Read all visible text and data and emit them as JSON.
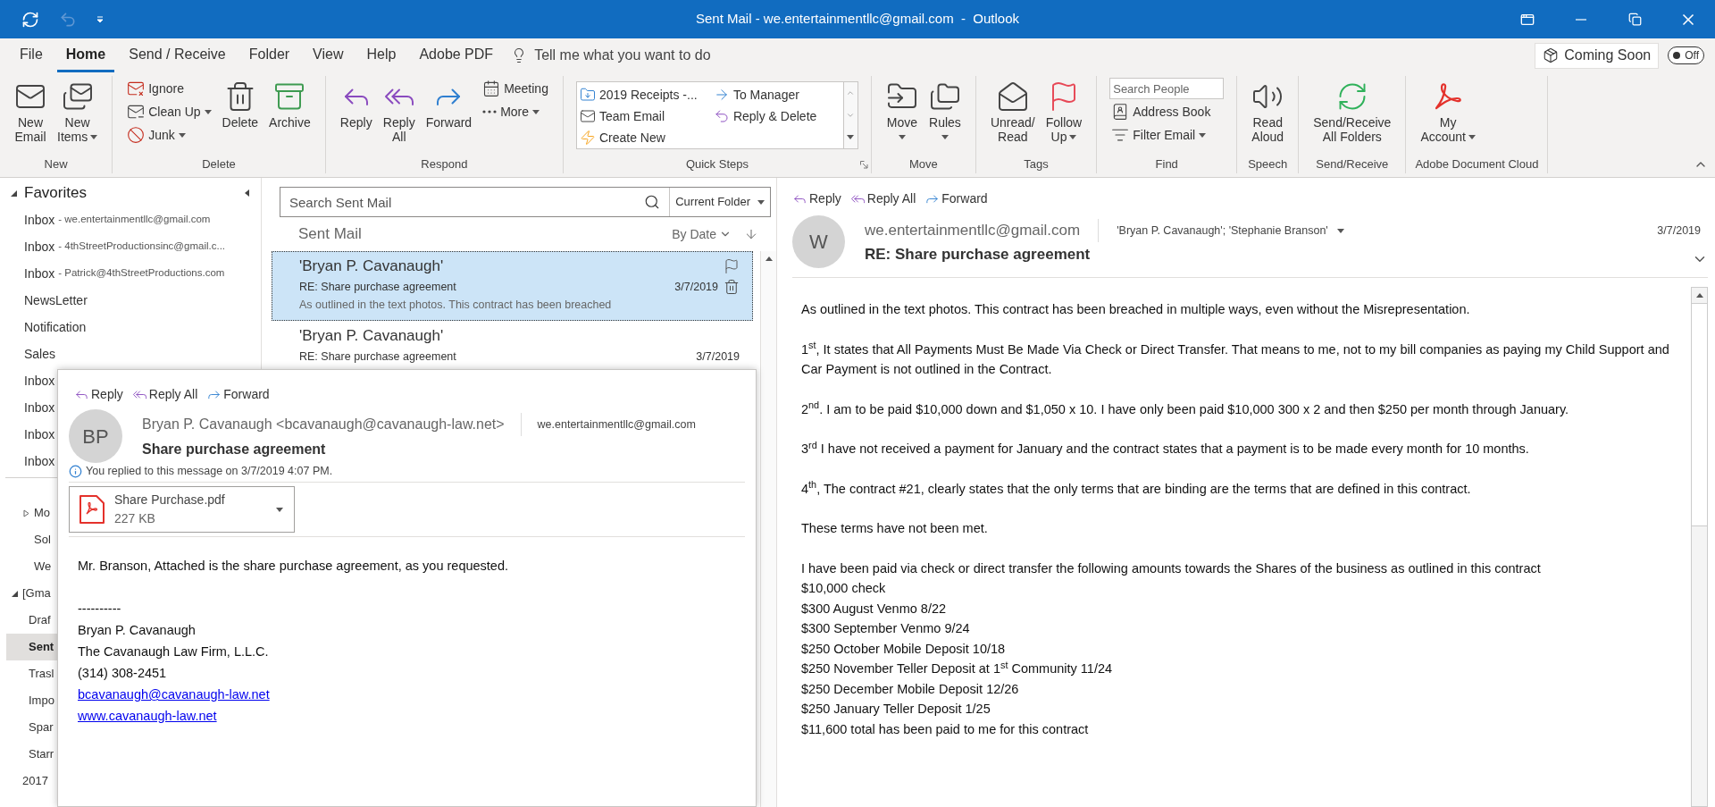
{
  "title_bar": {
    "title": "Sent Mail - we.entertainmentllc@gmail.com  -  Outlook",
    "undo": {
      "disabled": true
    }
  },
  "menu": {
    "tabs": [
      {
        "label": "File",
        "selected": false
      },
      {
        "label": "Home",
        "selected": true
      },
      {
        "label": "Send / Receive",
        "selected": false
      },
      {
        "label": "Folder",
        "selected": false
      },
      {
        "label": "View",
        "selected": false
      },
      {
        "label": "Help",
        "selected": false
      },
      {
        "label": "Adobe PDF",
        "selected": false
      }
    ],
    "tell_me": "Tell me what you want to do",
    "coming_soon": "Coming Soon",
    "toggle": {
      "label": "Off",
      "on": false
    }
  },
  "ribbon": {
    "groups": [
      {
        "label": "New",
        "launcher": false,
        "items": [
          {
            "kind": "large",
            "lines": [
              "New",
              "Email"
            ],
            "dropdown": false
          },
          {
            "kind": "large",
            "lines": [
              "New",
              "Items"
            ],
            "dropdown": true
          }
        ]
      },
      {
        "label": "Delete",
        "launcher": false,
        "items": [
          {
            "kind": "stack",
            "buttons": [
              {
                "label": "Ignore",
                "dropdown": false
              },
              {
                "label": "Clean Up",
                "dropdown": true
              },
              {
                "label": "Junk",
                "dropdown": true
              }
            ]
          },
          {
            "kind": "large",
            "lines": [
              "Delete"
            ],
            "dropdown": false
          },
          {
            "kind": "large",
            "lines": [
              "Archive"
            ],
            "dropdown": false
          }
        ]
      },
      {
        "label": "Respond",
        "launcher": false,
        "items": [
          {
            "kind": "large",
            "lines": [
              "Reply"
            ],
            "dropdown": false
          },
          {
            "kind": "large",
            "lines": [
              "Reply",
              "All"
            ],
            "dropdown": false
          },
          {
            "kind": "large",
            "lines": [
              "Forward"
            ],
            "dropdown": false
          },
          {
            "kind": "stack",
            "buttons": [
              {
                "label": "Meeting",
                "dropdown": false
              },
              {
                "label": "More",
                "dropdown": true
              }
            ]
          }
        ]
      },
      {
        "label": "Quick Steps",
        "launcher": true,
        "items": [
          {
            "kind": "gallery",
            "steps": [
              "2019 Receipts -...",
              "To Manager",
              "Team Email",
              "Reply & Delete",
              "Create New"
            ]
          }
        ]
      },
      {
        "label": "Move",
        "launcher": false,
        "items": [
          {
            "kind": "large",
            "lines": [
              "Move"
            ],
            "dropdown": true
          },
          {
            "kind": "large",
            "lines": [
              "Rules"
            ],
            "dropdown": true
          }
        ]
      },
      {
        "label": "Tags",
        "launcher": false,
        "items": [
          {
            "kind": "large",
            "lines": [
              "Unread/",
              "Read"
            ],
            "dropdown": false
          },
          {
            "kind": "large",
            "lines": [
              "Follow",
              "Up"
            ],
            "dropdown": true
          }
        ]
      },
      {
        "label": "Find",
        "launcher": false,
        "items": [
          {
            "kind": "stack",
            "placeholder": "Search People",
            "buttons": [
              {
                "label": "Address Book",
                "dropdown": false
              },
              {
                "label": "Filter Email",
                "dropdown": true
              }
            ]
          }
        ]
      },
      {
        "label": "Speech",
        "launcher": false,
        "items": [
          {
            "kind": "large",
            "lines": [
              "Read",
              "Aloud"
            ],
            "dropdown": false
          }
        ]
      },
      {
        "label": "Send/Receive",
        "launcher": false,
        "items": [
          {
            "kind": "large",
            "lines": [
              "Send/Receive",
              "All Folders"
            ],
            "dropdown": false
          }
        ]
      },
      {
        "label": "Adobe Document Cloud",
        "launcher": false,
        "items": [
          {
            "kind": "large",
            "lines": [
              "My",
              "Account"
            ],
            "dropdown": true
          }
        ]
      }
    ]
  },
  "folder_pane": {
    "title": "Favorites",
    "expanded": true,
    "favorites": [
      {
        "label": "Inbox",
        "detail": "- we.entertainmentllc@gmail.com",
        "selected": false
      },
      {
        "label": "Inbox",
        "detail": "- 4thStreetProductionsinc@gmail.c...",
        "selected": false
      },
      {
        "label": "Inbox",
        "detail": "- Patrick@4thStreetProductions.com",
        "selected": false
      },
      {
        "label": "NewsLetter",
        "selected": false
      },
      {
        "label": "Notification",
        "selected": false
      },
      {
        "label": "Sales",
        "selected": false
      },
      {
        "label": "Inbox",
        "selected": false
      },
      {
        "label": "Inbox",
        "selected": false
      },
      {
        "label": "Inbox",
        "selected": false
      },
      {
        "label": "Inbox",
        "selected": false
      }
    ],
    "folders_continued": [
      {
        "label": "Mo",
        "expanded": false,
        "selected": false
      },
      {
        "label": "Sol",
        "selected": false
      },
      {
        "label": "We",
        "selected": false
      }
    ],
    "folders": [
      {
        "label": "[Gma",
        "expanded": true,
        "selected": false,
        "children": [
          {
            "label": "Draf",
            "selected": false
          },
          {
            "label": "Sent",
            "selected": true
          },
          {
            "label": "Trasl",
            "selected": false
          },
          {
            "label": "Impo",
            "selected": false
          },
          {
            "label": "Spar",
            "selected": false
          },
          {
            "label": "Starr",
            "selected": false
          }
        ]
      },
      {
        "label": "2017",
        "selected": false
      }
    ]
  },
  "message_list": {
    "search": {
      "placeholder": "Search Sent Mail",
      "scope": "Current Folder"
    },
    "title": "Sent Mail",
    "sort": "By Date",
    "messages": [
      {
        "sender": "'Bryan P. Cavanaugh'",
        "subject": "RE: Share purchase agreement",
        "date": "3/7/2019",
        "preview": "As outlined in the text photos. This contract has been breached",
        "selected": true
      },
      {
        "sender": "'Bryan P. Cavanaugh'",
        "subject": "RE: Share purchase agreement",
        "date": "3/7/2019",
        "selected": false
      }
    ]
  },
  "reading_pane": {
    "actions": [
      "Reply",
      "Reply All",
      "Forward"
    ],
    "avatar": "W",
    "from": "we.entertainmentllc@gmail.com",
    "to": "'Bryan P. Cavanaugh'; 'Stephanie Branson'",
    "date": "3/7/2019",
    "subject": "RE: Share purchase agreement",
    "body": [
      {
        "lines": [
          "As outlined in the text photos. This contract has been breached in multiple ways, even without the Misrepresentation."
        ]
      },
      {
        "lines": [
          "1$^{st}$, It states that All Payments Must Be Made Via Check or Direct Transfer. That means to me, not to my bill companies as paying my Child Support and Car Payment is not outlined in the Contract."
        ]
      },
      {
        "lines": [
          "2$^{nd}$. I am to be paid $10,000 down and $1,050 x 10. I have only been paid $10,000 300 x 2 and then $250 per month through January."
        ]
      },
      {
        "lines": [
          "3$^{rd}$ I have not received a payment for January and the contract states that a payment is to be made every month for 10 months."
        ]
      },
      {
        "lines": [
          "4$^{th}$, The contract #21, clearly states that the only terms that are binding are the terms that are defined in this contract."
        ]
      },
      {
        "lines": [
          "These terms have not been met."
        ]
      },
      {
        "lines": [
          "I have been paid via check or direct transfer the following amounts towards the Shares of the business as outlined in this contract",
          "$10,000 check",
          "$300 August Venmo 8/22",
          "$300 September Venmo 9/24",
          "$250 October Mobile Deposit 10/18",
          "$250 November Teller Deposit at 1$^{st}$ Community 11/24",
          "$250 December Mobile Deposit 12/26",
          "$250 January Teller Deposit 1/25",
          "$11,600 total has been paid to me for this contract"
        ]
      }
    ]
  },
  "popup": {
    "actions": [
      "Reply",
      "Reply All",
      "Forward"
    ],
    "avatar": "BP",
    "from": "Bryan P. Cavanaugh <bcavanaugh@cavanaugh-law.net>",
    "to": "we.entertainmentllc@gmail.com",
    "subject": "Share purchase agreement",
    "info": "You replied to this message on 3/7/2019 4:07 PM.",
    "attachment": {
      "name": "Share Purchase.pdf",
      "size": "227 KB"
    },
    "body": "Mr. Branson, Attached is the share purchase agreement, as you requested.",
    "signature": [
      {
        "kind": "text",
        "text": "----------"
      },
      {
        "kind": "text",
        "text": "Bryan P. Cavanaugh"
      },
      {
        "kind": "text",
        "text": "The Cavanaugh Law Firm, L.L.C."
      },
      {
        "kind": "text",
        "text": "(314) 308-2451"
      },
      {
        "kind": "link",
        "text": "bcavanaugh@cavanaugh-law.net"
      },
      {
        "kind": "link",
        "text": "www.cavanaugh-law.net"
      }
    ]
  }
}
